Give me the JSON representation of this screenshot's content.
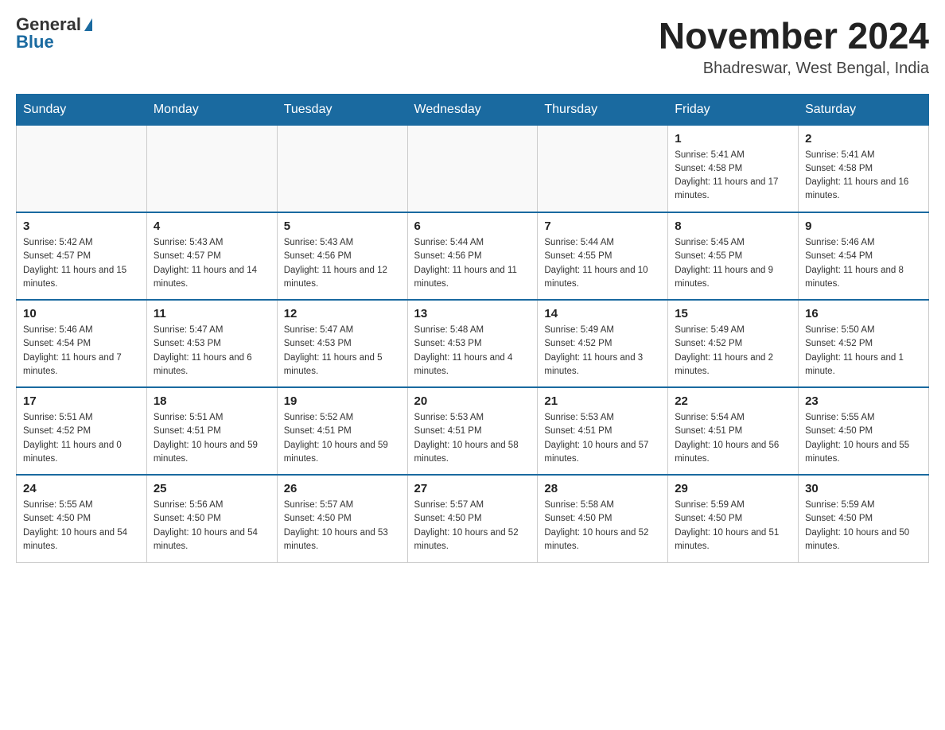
{
  "header": {
    "logo_general": "General",
    "logo_blue": "Blue",
    "month_title": "November 2024",
    "location": "Bhadreswar, West Bengal, India"
  },
  "days_of_week": [
    "Sunday",
    "Monday",
    "Tuesday",
    "Wednesday",
    "Thursday",
    "Friday",
    "Saturday"
  ],
  "weeks": [
    [
      {
        "day": "",
        "sunrise": "",
        "sunset": "",
        "daylight": ""
      },
      {
        "day": "",
        "sunrise": "",
        "sunset": "",
        "daylight": ""
      },
      {
        "day": "",
        "sunrise": "",
        "sunset": "",
        "daylight": ""
      },
      {
        "day": "",
        "sunrise": "",
        "sunset": "",
        "daylight": ""
      },
      {
        "day": "",
        "sunrise": "",
        "sunset": "",
        "daylight": ""
      },
      {
        "day": "1",
        "sunrise": "Sunrise: 5:41 AM",
        "sunset": "Sunset: 4:58 PM",
        "daylight": "Daylight: 11 hours and 17 minutes."
      },
      {
        "day": "2",
        "sunrise": "Sunrise: 5:41 AM",
        "sunset": "Sunset: 4:58 PM",
        "daylight": "Daylight: 11 hours and 16 minutes."
      }
    ],
    [
      {
        "day": "3",
        "sunrise": "Sunrise: 5:42 AM",
        "sunset": "Sunset: 4:57 PM",
        "daylight": "Daylight: 11 hours and 15 minutes."
      },
      {
        "day": "4",
        "sunrise": "Sunrise: 5:43 AM",
        "sunset": "Sunset: 4:57 PM",
        "daylight": "Daylight: 11 hours and 14 minutes."
      },
      {
        "day": "5",
        "sunrise": "Sunrise: 5:43 AM",
        "sunset": "Sunset: 4:56 PM",
        "daylight": "Daylight: 11 hours and 12 minutes."
      },
      {
        "day": "6",
        "sunrise": "Sunrise: 5:44 AM",
        "sunset": "Sunset: 4:56 PM",
        "daylight": "Daylight: 11 hours and 11 minutes."
      },
      {
        "day": "7",
        "sunrise": "Sunrise: 5:44 AM",
        "sunset": "Sunset: 4:55 PM",
        "daylight": "Daylight: 11 hours and 10 minutes."
      },
      {
        "day": "8",
        "sunrise": "Sunrise: 5:45 AM",
        "sunset": "Sunset: 4:55 PM",
        "daylight": "Daylight: 11 hours and 9 minutes."
      },
      {
        "day": "9",
        "sunrise": "Sunrise: 5:46 AM",
        "sunset": "Sunset: 4:54 PM",
        "daylight": "Daylight: 11 hours and 8 minutes."
      }
    ],
    [
      {
        "day": "10",
        "sunrise": "Sunrise: 5:46 AM",
        "sunset": "Sunset: 4:54 PM",
        "daylight": "Daylight: 11 hours and 7 minutes."
      },
      {
        "day": "11",
        "sunrise": "Sunrise: 5:47 AM",
        "sunset": "Sunset: 4:53 PM",
        "daylight": "Daylight: 11 hours and 6 minutes."
      },
      {
        "day": "12",
        "sunrise": "Sunrise: 5:47 AM",
        "sunset": "Sunset: 4:53 PM",
        "daylight": "Daylight: 11 hours and 5 minutes."
      },
      {
        "day": "13",
        "sunrise": "Sunrise: 5:48 AM",
        "sunset": "Sunset: 4:53 PM",
        "daylight": "Daylight: 11 hours and 4 minutes."
      },
      {
        "day": "14",
        "sunrise": "Sunrise: 5:49 AM",
        "sunset": "Sunset: 4:52 PM",
        "daylight": "Daylight: 11 hours and 3 minutes."
      },
      {
        "day": "15",
        "sunrise": "Sunrise: 5:49 AM",
        "sunset": "Sunset: 4:52 PM",
        "daylight": "Daylight: 11 hours and 2 minutes."
      },
      {
        "day": "16",
        "sunrise": "Sunrise: 5:50 AM",
        "sunset": "Sunset: 4:52 PM",
        "daylight": "Daylight: 11 hours and 1 minute."
      }
    ],
    [
      {
        "day": "17",
        "sunrise": "Sunrise: 5:51 AM",
        "sunset": "Sunset: 4:52 PM",
        "daylight": "Daylight: 11 hours and 0 minutes."
      },
      {
        "day": "18",
        "sunrise": "Sunrise: 5:51 AM",
        "sunset": "Sunset: 4:51 PM",
        "daylight": "Daylight: 10 hours and 59 minutes."
      },
      {
        "day": "19",
        "sunrise": "Sunrise: 5:52 AM",
        "sunset": "Sunset: 4:51 PM",
        "daylight": "Daylight: 10 hours and 59 minutes."
      },
      {
        "day": "20",
        "sunrise": "Sunrise: 5:53 AM",
        "sunset": "Sunset: 4:51 PM",
        "daylight": "Daylight: 10 hours and 58 minutes."
      },
      {
        "day": "21",
        "sunrise": "Sunrise: 5:53 AM",
        "sunset": "Sunset: 4:51 PM",
        "daylight": "Daylight: 10 hours and 57 minutes."
      },
      {
        "day": "22",
        "sunrise": "Sunrise: 5:54 AM",
        "sunset": "Sunset: 4:51 PM",
        "daylight": "Daylight: 10 hours and 56 minutes."
      },
      {
        "day": "23",
        "sunrise": "Sunrise: 5:55 AM",
        "sunset": "Sunset: 4:50 PM",
        "daylight": "Daylight: 10 hours and 55 minutes."
      }
    ],
    [
      {
        "day": "24",
        "sunrise": "Sunrise: 5:55 AM",
        "sunset": "Sunset: 4:50 PM",
        "daylight": "Daylight: 10 hours and 54 minutes."
      },
      {
        "day": "25",
        "sunrise": "Sunrise: 5:56 AM",
        "sunset": "Sunset: 4:50 PM",
        "daylight": "Daylight: 10 hours and 54 minutes."
      },
      {
        "day": "26",
        "sunrise": "Sunrise: 5:57 AM",
        "sunset": "Sunset: 4:50 PM",
        "daylight": "Daylight: 10 hours and 53 minutes."
      },
      {
        "day": "27",
        "sunrise": "Sunrise: 5:57 AM",
        "sunset": "Sunset: 4:50 PM",
        "daylight": "Daylight: 10 hours and 52 minutes."
      },
      {
        "day": "28",
        "sunrise": "Sunrise: 5:58 AM",
        "sunset": "Sunset: 4:50 PM",
        "daylight": "Daylight: 10 hours and 52 minutes."
      },
      {
        "day": "29",
        "sunrise": "Sunrise: 5:59 AM",
        "sunset": "Sunset: 4:50 PM",
        "daylight": "Daylight: 10 hours and 51 minutes."
      },
      {
        "day": "30",
        "sunrise": "Sunrise: 5:59 AM",
        "sunset": "Sunset: 4:50 PM",
        "daylight": "Daylight: 10 hours and 50 minutes."
      }
    ]
  ]
}
